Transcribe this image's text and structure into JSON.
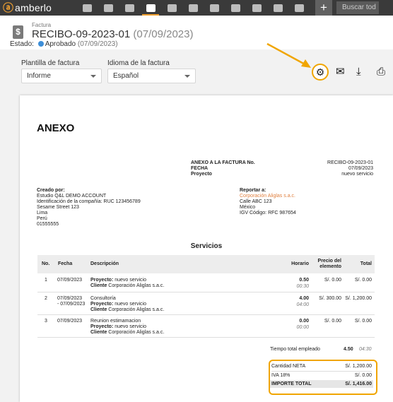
{
  "app": {
    "name": "amberlo",
    "logo_icon": "amberlo-logo-icon",
    "accent": "#f0a500"
  },
  "nav": {
    "items": [
      "dashboard-icon",
      "contacts-icon",
      "matters-icon",
      "billing-icon",
      "bank-icon",
      "calendar-icon",
      "time-icon",
      "folder-icon",
      "file-search-icon",
      "mail-icon",
      "reports-icon"
    ],
    "active_index": 3,
    "add_label": "+",
    "search_placeholder": "Buscar tod"
  },
  "invoice": {
    "type_label": "Factura",
    "number": "RECIBO-09-2023-01",
    "date_display": "(07/09/2023)",
    "status_label": "Estado:",
    "status": "Aprobado",
    "status_date": "(07/09/2023)",
    "status_color": "#3d8ed8"
  },
  "controls": {
    "template_label": "Plantilla de factura",
    "template_value": "Informe",
    "language_label": "Idioma de la factura",
    "language_value": "Español",
    "toolbar_icons": [
      "gear-icon",
      "mail-icon",
      "download-icon",
      "print-icon"
    ]
  },
  "document": {
    "title": "ANEXO",
    "meta_labels": [
      "ANEXO A LA FACTURA No.",
      "FECHA",
      "Proyecto"
    ],
    "meta_values": [
      "RECIBO-09-2023-01",
      "07/09/2023",
      "nuevo servicio"
    ],
    "created_by_label": "Creado por:",
    "created_by_lines": [
      "Estudio Q&L DEMO ACCOUNT",
      "Identificación de la compañía: RUC 123456789",
      "Sesame Street 123",
      "Lima",
      "Perú",
      "01555555"
    ],
    "report_to_label": "Reportar a:",
    "report_to_company": "Corporación Aliglas s.a.c.",
    "report_to_lines": [
      "Calle ABC 123",
      "México",
      "IGV Código: RFC 987654"
    ],
    "services_title": "Servicios",
    "columns": {
      "no": "No.",
      "date": "Fecha",
      "desc": "Descripción",
      "hours": "Horario",
      "unit_price": "Precio del elemento",
      "total": "Total"
    },
    "rows": [
      {
        "no": "1",
        "date": "07/09/2023",
        "date2": "",
        "desc": "",
        "project_label": "Proyecto:",
        "project": "nuevo servicio",
        "client_label": "Cliente",
        "client": "Corporación Aliglas s.a.c.",
        "hours": "0.50",
        "time": "00:30",
        "price": "S/. 0.00",
        "total": "S/. 0.00"
      },
      {
        "no": "2",
        "date": "07/09/2023",
        "date2": "- 07/09/2023",
        "desc": "Consultoría",
        "project_label": "Proyecto:",
        "project": "nuevo servicio",
        "client_label": "Cliente",
        "client": "Corporación Aliglas s.a.c.",
        "hours": "4.00",
        "time": "04:00",
        "price": "S/. 300.00",
        "total": "S/. 1,200.00"
      },
      {
        "no": "3",
        "date": "07/09/2023",
        "date2": "",
        "desc": "Reunion estimamacion",
        "project_label": "Proyecto:",
        "project": "nuevo servicio",
        "client_label": "Cliente",
        "client": "Corporación Aliglas s.a.c.",
        "hours": "0.00",
        "time": "00:00",
        "price": "S/. 0.00",
        "total": "S/. 0.00"
      }
    ],
    "total_time_label": "Tiempo total empleado",
    "total_time_hours": "4.50",
    "total_time_hm": "04:30",
    "net_label": "Cantidad NETA",
    "net_value": "S/. 1,200.00",
    "tax_label": "IVA 18%",
    "tax_value": "S/. 0.00",
    "grand_label": "IMPORTE TOTAL",
    "grand_value": "S/. 1,416.00"
  }
}
